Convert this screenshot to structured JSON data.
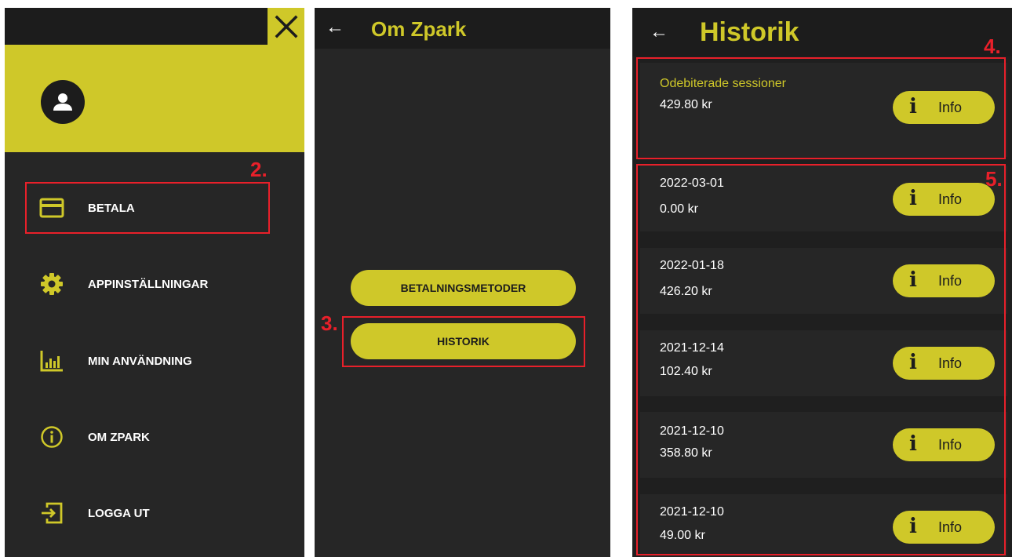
{
  "drawer": {
    "menu": [
      {
        "label": "BETALA",
        "icon": "credit-card-icon"
      },
      {
        "label": "APPINSTÄLLNINGAR",
        "icon": "gear-icon"
      },
      {
        "label": "MIN ANVÄNDNING",
        "icon": "bar-chart-icon"
      },
      {
        "label": "OM ZPARK",
        "icon": "info-circle-icon"
      },
      {
        "label": "LOGGA UT",
        "icon": "logout-icon"
      }
    ]
  },
  "about": {
    "title": "Om Zpark",
    "buttons": [
      "BETALNINGSMETODER",
      "HISTORIK"
    ]
  },
  "history": {
    "title": "Historik",
    "unbilled": {
      "title": "Odebiterade sessioner",
      "amount": "429.80 kr"
    },
    "sessions": [
      {
        "date": "2022-03-01",
        "amount": "0.00 kr"
      },
      {
        "date": "2022-01-18",
        "amount": "426.20 kr"
      },
      {
        "date": "2021-12-14",
        "amount": "102.40 kr"
      },
      {
        "date": "2021-12-10",
        "amount": "358.80 kr"
      },
      {
        "date": "2021-12-10",
        "amount": "49.00 kr"
      }
    ],
    "info_label": "Info"
  },
  "annotations": [
    "2.",
    "3.",
    "4.",
    "5."
  ],
  "colors": {
    "accent": "#cfc829",
    "background": "#262626",
    "annotation": "#e8202a"
  }
}
